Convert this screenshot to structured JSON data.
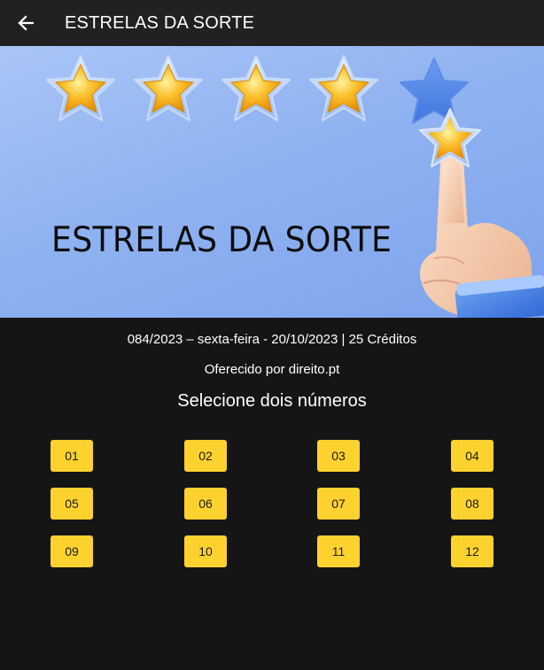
{
  "header": {
    "back_icon": "arrow-left-icon",
    "title": "ESTRELAS DA SORTE"
  },
  "banner": {
    "text": "ESTRELAS DA SORTE",
    "stars_filled": 4,
    "stars_total": 5,
    "colors": {
      "background": "#8fb2f1",
      "star": "#fbc02d",
      "hand_skin": "#f6cfb0",
      "sleeve": "#3f7be0"
    }
  },
  "draw_info": {
    "meta": "084/2023 – sexta-feira - 20/10/2023 | 25 Créditos",
    "offered_by": "Oferecido por direito.pt",
    "prompt": "Selecione dois números"
  },
  "numbers": [
    "01",
    "02",
    "03",
    "04",
    "05",
    "06",
    "07",
    "08",
    "09",
    "10",
    "11",
    "12"
  ],
  "colors": {
    "page_bg": "#151515",
    "topbar_bg": "#212121",
    "number_button": "#fdd22f",
    "text": "#ffffff"
  }
}
